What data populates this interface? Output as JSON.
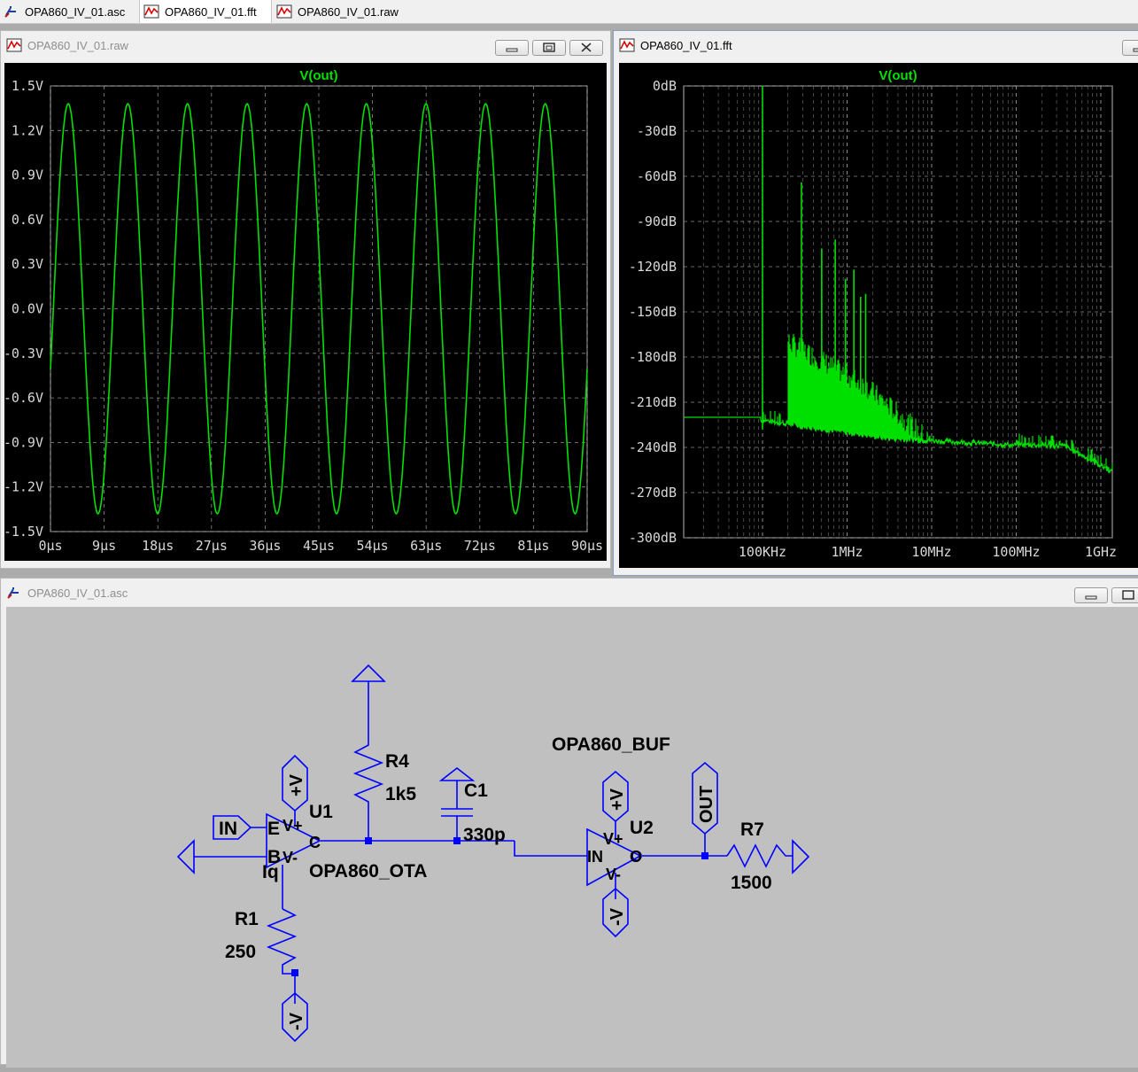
{
  "tabs": [
    {
      "label": "OPA860_IV_01.asc",
      "icon": "schematic-icon",
      "active": false
    },
    {
      "label": "OPA860_IV_01.fft",
      "icon": "waveform-icon",
      "active": true
    },
    {
      "label": "OPA860_IV_01.raw",
      "icon": "waveform-icon",
      "active": false
    }
  ],
  "windows": {
    "raw": {
      "title": "OPA860_IV_01.raw"
    },
    "fft": {
      "title": "OPA860_IV_01.fft"
    },
    "asc": {
      "title": "OPA860_IV_01.asc"
    }
  },
  "colors": {
    "trace": "#00e000",
    "plot_bg": "#000000",
    "schematic_wire": "#0000ff",
    "schematic_text": "#000000"
  },
  "chart_data": [
    {
      "type": "line",
      "title": "V(out)",
      "x_ticks": [
        "0µs",
        "9µs",
        "18µs",
        "27µs",
        "36µs",
        "45µs",
        "54µs",
        "63µs",
        "72µs",
        "81µs",
        "90µs"
      ],
      "y_ticks": [
        "1.5V",
        "1.2V",
        "0.9V",
        "0.6V",
        "0.3V",
        "0.0V",
        "-0.3V",
        "-0.6V",
        "-0.9V",
        "-1.2V",
        "-1.5V"
      ],
      "xlim": [
        0,
        90
      ],
      "ylim": [
        -1.5,
        1.5
      ],
      "grid": true,
      "series": [
        {
          "name": "V(out)",
          "amplitude": 1.38,
          "cycles": 9
        }
      ]
    },
    {
      "type": "line",
      "title": "V(out)",
      "x_ticks": [
        "100KHz",
        "1MHz",
        "10MHz",
        "100MHz",
        "1GHz"
      ],
      "y_ticks": [
        "0dB",
        "-30dB",
        "-60dB",
        "-90dB",
        "-120dB",
        "-150dB",
        "-180dB",
        "-210dB",
        "-240dB",
        "-270dB",
        "-300dB"
      ],
      "ylim": [
        -300,
        0
      ],
      "x_scale": "log",
      "grid": true,
      "series": [
        {
          "name": "V(out)",
          "fundamental_hz": 100000,
          "fundamental_db": 0,
          "noise_floor_db": -220
        }
      ]
    }
  ],
  "schematic": {
    "labels": {
      "r4": "R4",
      "r4_val": "1k5",
      "c1": "C1",
      "c1_val": "330p",
      "u1": "U1",
      "u1_model": "OPA860_OTA",
      "u2": "U2",
      "u2_model": "OPA860_BUF",
      "r1": "R1",
      "r1_val": "250",
      "r7": "R7",
      "r7_val": "1500",
      "in_port": "IN",
      "out_port": "OUT",
      "vplus": "+V",
      "vminus": "-V",
      "pin_e": "E",
      "pin_b": "B",
      "pin_c": "C",
      "pin_iq": "Iq",
      "pin_vp": "V+",
      "pin_vm": "V-",
      "pin_in": "IN",
      "pin_o": "O"
    }
  }
}
